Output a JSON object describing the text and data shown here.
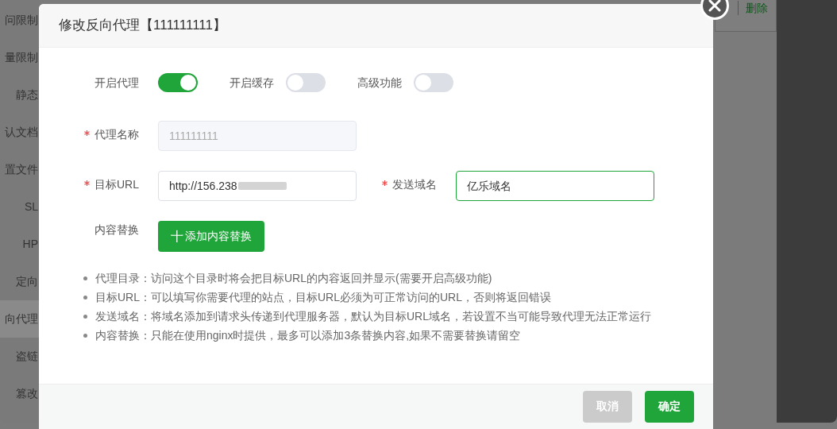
{
  "background": {
    "sidebar_items": [
      {
        "label": "问限制",
        "selected": false
      },
      {
        "label": "量限制",
        "selected": false
      },
      {
        "label": "静态",
        "selected": false
      },
      {
        "label": "认文档",
        "selected": false
      },
      {
        "label": "置文件",
        "selected": false
      },
      {
        "label": "SL",
        "selected": false
      },
      {
        "label": "HP",
        "selected": false
      },
      {
        "label": "定向",
        "selected": false
      },
      {
        "label": "向代理",
        "selected": true
      },
      {
        "label": "盗链",
        "selected": false
      },
      {
        "label": "篡改",
        "selected": false
      }
    ],
    "row_action": "删除"
  },
  "dialog": {
    "title": "修改反向代理【111111111】",
    "switches": [
      {
        "label": "开启代理",
        "on": true
      },
      {
        "label": "开启缓存",
        "on": false
      },
      {
        "label": "高级功能",
        "on": false
      }
    ],
    "fields": [
      {
        "label": "代理名称",
        "required": true,
        "value": "111111111",
        "disabled": true,
        "focused": false
      },
      {
        "label": "目标URL",
        "required": true,
        "value": "http://156.238",
        "disabled": false,
        "focused": false,
        "blurred": true
      },
      {
        "label": "发送域名",
        "required": true,
        "value": "亿乐域名",
        "disabled": false,
        "focused": true
      }
    ],
    "content_replace": {
      "label": "内容替换",
      "button_icon": "十",
      "button": "添加内容替换"
    },
    "notes": [
      "代理目录：访问这个目录时将会把目标URL的内容返回并显示(需要开启高级功能)",
      "目标URL：可以填写你需要代理的站点，目标URL必须为可正常访问的URL，否则将返回错误",
      "发送域名：将域名添加到请求头传递到代理服务器，默认为目标URL域名，若设置不当可能导致代理无法正常运行",
      "内容替换：只能在使用nginx时提供，最多可以添加3条替换内容,如果不需要替换请留空"
    ],
    "buttons": [
      {
        "label": "取消",
        "kind": "cancel"
      },
      {
        "label": "确定",
        "kind": "confirm"
      }
    ]
  }
}
